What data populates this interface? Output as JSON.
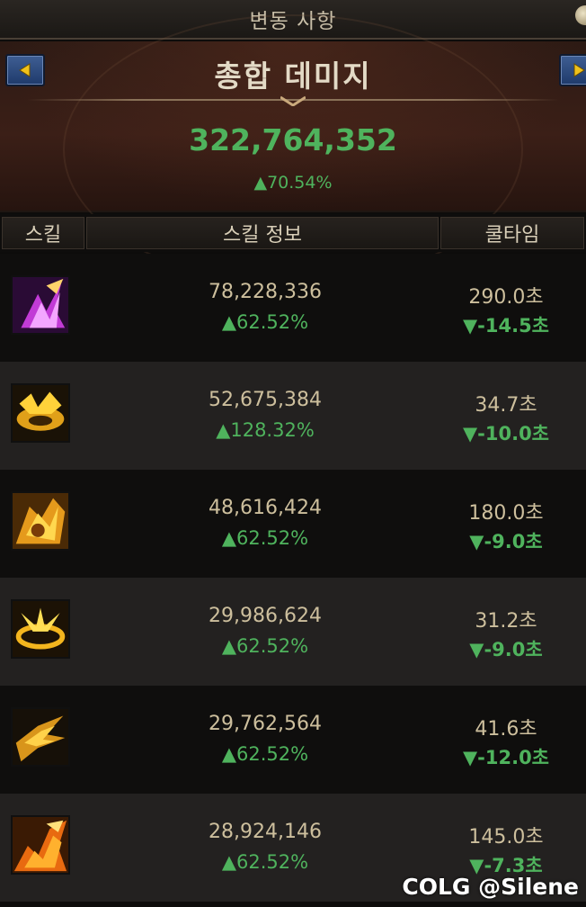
{
  "title_bar": {
    "title": "변동 사항"
  },
  "header": {
    "label": "총합 데미지",
    "total": "322,764,352",
    "total_change": "▲70.54%"
  },
  "columns": {
    "skill": "스킬",
    "info": "스킬 정보",
    "cooldown": "쿨타임"
  },
  "rows": [
    {
      "damage": "78,228,336",
      "damage_change": "▲62.52%",
      "cooldown": "290.0초",
      "cooldown_change": "▼-14.5초",
      "icon": "purple-flame-skill-icon"
    },
    {
      "damage": "52,675,384",
      "damage_change": "▲128.32%",
      "cooldown": "34.7초",
      "cooldown_change": "▼-10.0초",
      "icon": "golden-burst-skill-icon"
    },
    {
      "damage": "48,616,424",
      "damage_change": "▲62.52%",
      "cooldown": "180.0초",
      "cooldown_change": "▼-9.0초",
      "icon": "golden-fist-skill-icon"
    },
    {
      "damage": "29,986,624",
      "damage_change": "▲62.52%",
      "cooldown": "31.2초",
      "cooldown_change": "▼-9.0초",
      "icon": "golden-ring-skill-icon"
    },
    {
      "damage": "29,762,564",
      "damage_change": "▲62.52%",
      "cooldown": "41.6초",
      "cooldown_change": "▼-12.0초",
      "icon": "golden-slash-skill-icon"
    },
    {
      "damage": "28,924,146",
      "damage_change": "▲62.52%",
      "cooldown": "145.0초",
      "cooldown_change": "▼-7.3초",
      "icon": "orange-flame-skill-icon"
    }
  ],
  "watermark": "COLG @Silene",
  "colors": {
    "positive": "#4fb35d",
    "value": "#cdbf9d",
    "nav_button": "#2c4a80"
  }
}
